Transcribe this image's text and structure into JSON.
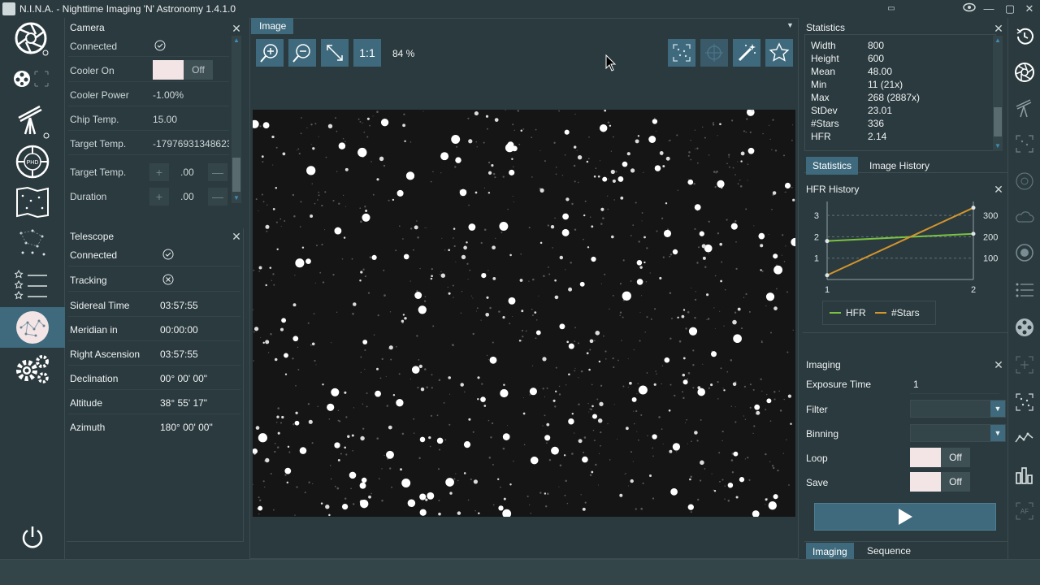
{
  "window": {
    "title": "N.I.N.A. - Nighttime Imaging 'N' Astronomy 1.4.1.0"
  },
  "camera": {
    "title": "Camera",
    "connected_label": "Connected",
    "cooler_on_label": "Cooler On",
    "cooler_state": "Off",
    "cooler_power_label": "Cooler Power",
    "cooler_power": "-1.00%",
    "chip_temp_label": "Chip Temp.",
    "chip_temp": "15.00",
    "target_temp_label": "Target Temp.",
    "target_temp_value": "-17976931348623",
    "target_temp2_label": "Target Temp.",
    "target_temp_input": ".00",
    "duration_label": "Duration",
    "duration_input": ".00"
  },
  "telescope": {
    "title": "Telescope",
    "rows": [
      {
        "label": "Connected",
        "value": ""
      },
      {
        "label": "Tracking",
        "value": ""
      },
      {
        "label": "Sidereal Time",
        "value": "03:57:55"
      },
      {
        "label": "Meridian in",
        "value": "00:00:00"
      },
      {
        "label": "Right Ascension",
        "value": "03:57:55"
      },
      {
        "label": "Declination",
        "value": "00° 00' 00\""
      },
      {
        "label": "Altitude",
        "value": "38° 55' 17\""
      },
      {
        "label": "Azimuth",
        "value": "180° 00' 00\""
      }
    ]
  },
  "image": {
    "tab": "Image",
    "one_to_one": "1:1",
    "zoom": "84 %"
  },
  "statistics": {
    "title": "Statistics",
    "rows": [
      {
        "label": "Width",
        "value": "800"
      },
      {
        "label": "Height",
        "value": "600"
      },
      {
        "label": "Mean",
        "value": "48.00"
      },
      {
        "label": "Min",
        "value": "11 (21x)"
      },
      {
        "label": "Max",
        "value": "268 (2887x)"
      },
      {
        "label": "StDev",
        "value": "23.01"
      },
      {
        "label": "#Stars",
        "value": "336"
      },
      {
        "label": "HFR",
        "value": "2.14"
      }
    ],
    "tab_statistics": "Statistics",
    "tab_history": "Image History"
  },
  "hfr_history": {
    "title": "HFR History",
    "left_ticks": [
      "3",
      "2",
      "1"
    ],
    "right_ticks": [
      "300",
      "200",
      "100"
    ],
    "x_ticks": [
      "1",
      "2"
    ],
    "legend_hfr": "HFR",
    "legend_stars": "#Stars",
    "colors": {
      "hfr": "#7cc242",
      "stars": "#d4952b"
    }
  },
  "chart_data": {
    "type": "line",
    "x": [
      1,
      2
    ],
    "series": [
      {
        "name": "HFR",
        "values": [
          1.8,
          2.14
        ],
        "axis": "left"
      },
      {
        "name": "#Stars",
        "values": [
          20,
          336
        ],
        "axis": "right"
      }
    ],
    "ylim_left": [
      0,
      3.5
    ],
    "ylim_right": [
      0,
      350
    ],
    "legend": "bottom"
  },
  "imaging": {
    "title": "Imaging",
    "exposure_label": "Exposure Time",
    "exposure_value": "1",
    "filter_label": "Filter",
    "binning_label": "Binning",
    "loop_label": "Loop",
    "loop_state": "Off",
    "save_label": "Save",
    "save_state": "Off",
    "tab_imaging": "Imaging",
    "tab_sequence": "Sequence"
  }
}
